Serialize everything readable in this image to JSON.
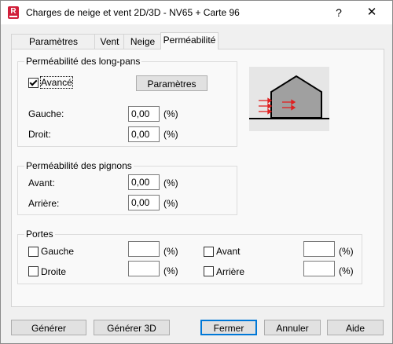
{
  "titlebar": {
    "app_icon": "revit-app-icon",
    "app_icon_letter": "R",
    "title": "Charges de neige et vent 2D/3D - NV65 + Carte 96",
    "help_label": "?",
    "close_label": "✕"
  },
  "tabs": [
    {
      "label": "Paramètres globaux",
      "active": false
    },
    {
      "label": "Vent",
      "active": false
    },
    {
      "label": "Neige",
      "active": false
    },
    {
      "label": "Perméabilité",
      "active": true
    }
  ],
  "long_pans": {
    "title": "Perméabilité des long-pans",
    "avance_label": "Avancé",
    "avance_checked": true,
    "parametres_button": "Paramètres",
    "gauche_label": "Gauche:",
    "gauche_value": "0,00",
    "droit_label": "Droit:",
    "droit_value": "0,00",
    "unit": "(%)"
  },
  "pignons": {
    "title": "Perméabilité des pignons",
    "avant_label": "Avant:",
    "avant_value": "0,00",
    "arriere_label": "Arrière:",
    "arriere_value": "0,00",
    "unit": "(%)"
  },
  "portes": {
    "title": "Portes",
    "gauche_label": "Gauche",
    "droite_label": "Droite",
    "avant_label": "Avant",
    "arriere_label": "Arrière",
    "unit": "(%)",
    "gauche_value": "",
    "droite_value": "",
    "avant_value": "",
    "arriere_value": ""
  },
  "preview": {
    "icon": "building-wind-diagram",
    "arrow_color": "#e02020",
    "building_color": "#a0a0a0"
  },
  "footer": {
    "generer": "Générer",
    "generer3d": "Générer 3D",
    "fermer": "Fermer",
    "annuler": "Annuler",
    "aide": "Aide"
  }
}
